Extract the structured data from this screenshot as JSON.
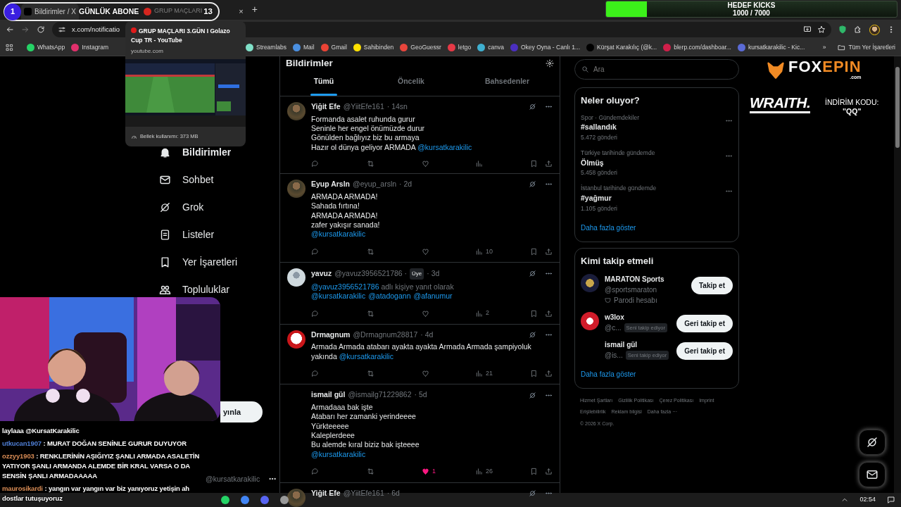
{
  "stream_overlay": {
    "daily_subs": {
      "badge": "1",
      "label": "GÜNLÜK ABONE",
      "count": "13"
    },
    "goal": {
      "title": "HEDEF KİCKS",
      "reading": "1000 / 7000",
      "level": 0.14
    },
    "chat": [
      {
        "message": "laylaaa @KursatKarakilic"
      },
      {
        "user": "utkucan1907",
        "color": "#4f7fd6",
        "message": ": MURAT DOĞAN SENİNLE GURUR DUYUYOR"
      },
      {
        "user": "ozzyy1903",
        "color": "#d98c55",
        "message": ": RENKLERİNİN AŞIĞIYIZ ŞANLI ARMADA ASALETİN YATIYOR ŞANLI ARMANDA ALEMDE BİR KRAL VARSA O DA SENSİN ŞANLI ARMADAAAAA"
      },
      {
        "user": "maurosikardi",
        "color": "#d98c55",
        "message": ": yangın var yangın var biz yanıyoruz yetişin ah dostlar tutuşuyoruz"
      }
    ],
    "sponsor": {
      "brand_a": "FOX",
      "brand_b": "EPIN",
      "domain": ".com",
      "brand2": "WRAITH.",
      "code_label": "İNDİRİM KODU:",
      "code": "\"QQ\""
    }
  },
  "browser": {
    "tabs": [
      {
        "title": "Bildirimler / X",
        "selected": true
      },
      {
        "title": "GRUP MAÇLARI",
        "selected": false
      }
    ],
    "new_tab": "+",
    "close": "×",
    "address": "x.com/notificatio",
    "tooltip": {
      "title": "GRUP MAÇLARI 3.GÜN I Golazo Cup TR - YouTube",
      "url": "youtube.com",
      "memory": "Bellek kullanımı: 373 MB"
    },
    "bookmarks_left": [
      "WhatsApp",
      "Instagram"
    ],
    "bookmarks": [
      "Streamlabs",
      "Mail",
      "Gmail",
      "Sahibinden",
      "GeoGuessr",
      "letgo",
      "canva",
      "Okey Oyna - Canlı 1...",
      "Kürşat Karakılıç (@k...",
      "blerp.com/dashboar...",
      "kursatkarakilic - Kic..."
    ],
    "more": "»",
    "all_bookmarks": "Tüm Yer İşaretleri"
  },
  "sidebar": {
    "items": [
      {
        "label": "Bildirimler",
        "selected": true
      },
      {
        "label": "Sohbet",
        "selected": false
      },
      {
        "label": "Grok",
        "selected": false
      },
      {
        "label": "Listeler",
        "selected": false
      },
      {
        "label": "Yer İşaretleri",
        "selected": false
      },
      {
        "label": "Topluluklar",
        "selected": false
      }
    ],
    "post_button": "yınla",
    "account_handle": "@kursatkarakilic"
  },
  "notifications": {
    "title": "Bildirimler",
    "tabs": [
      {
        "label": "Tümü",
        "selected": true
      },
      {
        "label": "Öncelik",
        "selected": false
      },
      {
        "label": "Bahsedenler",
        "selected": false
      }
    ],
    "posts": [
      {
        "avatar": true,
        "name": "Yiğit Efe",
        "handle": "@YiitEfe161",
        "time": "· 14sn",
        "lines": [
          [
            {
              "kind": "text",
              "text": "Formanda asalet ruhunda gurur"
            }
          ],
          [
            {
              "kind": "text",
              "text": "Seninle her engel önümüzde durur"
            }
          ],
          [
            {
              "kind": "text",
              "text": "Gönülden bağlıyız biz bu armaya"
            }
          ],
          [
            {
              "kind": "text",
              "text": "Hazır ol dünya geliyor ARMADA "
            },
            {
              "kind": "mention",
              "text": "@kursatkarakilic"
            }
          ]
        ],
        "liked": false
      },
      {
        "avatar": true,
        "name": "Eyup Arsln",
        "handle": "@eyup_arsln",
        "time": "· 2d",
        "lines": [
          [
            {
              "kind": "text",
              "text": "ARMADA ARMADA!"
            }
          ],
          [
            {
              "kind": "text",
              "text": "Sahada fırtına!"
            }
          ],
          [
            {
              "kind": "text",
              "text": "ARMADA ARMADA!"
            }
          ],
          [
            {
              "kind": "text",
              "text": "zafer yakışır sanada!"
            }
          ],
          [
            {
              "kind": "mention",
              "text": "@kursatkarakilic"
            }
          ]
        ],
        "liked": false,
        "views": "10"
      },
      {
        "avatar": true,
        "name": "yavuz",
        "handle": "@yavuz3956521786 ·",
        "badge": "Üye",
        "time": "· 3d",
        "lines": [
          [
            {
              "kind": "mention",
              "text": "@yavuz3956521786"
            },
            {
              "kind": "muted",
              "text": " adlı kişiye yanıt olarak"
            }
          ],
          [
            {
              "kind": "mention",
              "text": "@kursatkarakilic"
            },
            {
              "kind": "mention",
              "text": "@atadogann"
            },
            {
              "kind": "mention",
              "text": "@afanumur"
            }
          ]
        ],
        "liked": false,
        "views": "2"
      },
      {
        "avatar": true,
        "name": "Drmagnum",
        "handle": "@Drmagnum28817",
        "time": "· 4d",
        "lines": [
          [
            {
              "kind": "text",
              "text": "Armada Armada atabarı ayakta ayakta Armada Armada şampiyoluk yakında "
            },
            {
              "kind": "mention",
              "text": "@kursatkarakilic"
            }
          ]
        ],
        "liked": false,
        "views": "21"
      },
      {
        "avatar": false,
        "name": "ismail gül",
        "handle": "@ismailg71229862",
        "time": "· 5d",
        "lines": [
          [
            {
              "kind": "text",
              "text": "Armadaaa bak işte"
            }
          ],
          [
            {
              "kind": "text",
              "text": "Atabarı her zamanki yerindeeee"
            }
          ],
          [
            {
              "kind": "text",
              "text": "Yürkteeeee"
            }
          ],
          [
            {
              "kind": "text",
              "text": "Kaleplerdeee"
            }
          ],
          [
            {
              "kind": "text",
              "text": "Bu alemde kıral biziz bak işteeee"
            }
          ],
          [
            {
              "kind": "mention",
              "text": "@kursatkarakilic"
            }
          ]
        ],
        "liked": true,
        "likes": "1",
        "views": "26"
      },
      {
        "avatar": true,
        "name": "Yiğit Efe",
        "handle": "@YiitEfe161",
        "time": "· 6d"
      }
    ]
  },
  "right": {
    "search": {
      "placeholder": "Ara"
    },
    "trends": {
      "title": "Neler oluyor?",
      "items": [
        {
          "context": "Spor · Gündemdekiler",
          "topic": "#sallandık",
          "count": "5.472 gönderi"
        },
        {
          "context": "Türkiye tarihinde gündemde",
          "topic": "Ölmüş",
          "count": "5.458 gönderi"
        },
        {
          "context": "İstanbul tarihinde gündemde",
          "topic": "#yağmur",
          "count": "1.105 gönderi"
        }
      ],
      "more": "Daha fazla göster"
    },
    "who_to_follow": {
      "title": "Kimi takip etmeli",
      "items": [
        {
          "avatar": true,
          "name": "MARATON Sports",
          "handle": "@sportsmaraton",
          "note": "Parodi hesabı",
          "button": "Takip et"
        },
        {
          "avatar": true,
          "name": "w3lox",
          "handle": "@c...",
          "follows_you": "Seni takip ediyor",
          "button": "Geri takip et"
        },
        {
          "avatar": false,
          "name": "ismail gül",
          "handle": "@is...",
          "follows_you": "Seni takip ediyor",
          "button": "Geri takip et"
        }
      ],
      "more": "Daha fazla göster"
    },
    "footer": [
      "Hizmet Şartları",
      "Gizlilik Politikası",
      "Çerez Politikası",
      "Imprint",
      "Erişilebilirlik",
      "Reklam bilgisi",
      "Daha fazla ···"
    ],
    "copyright": "© 2026 X Corp."
  },
  "taskbar": {
    "time": "02:54"
  }
}
